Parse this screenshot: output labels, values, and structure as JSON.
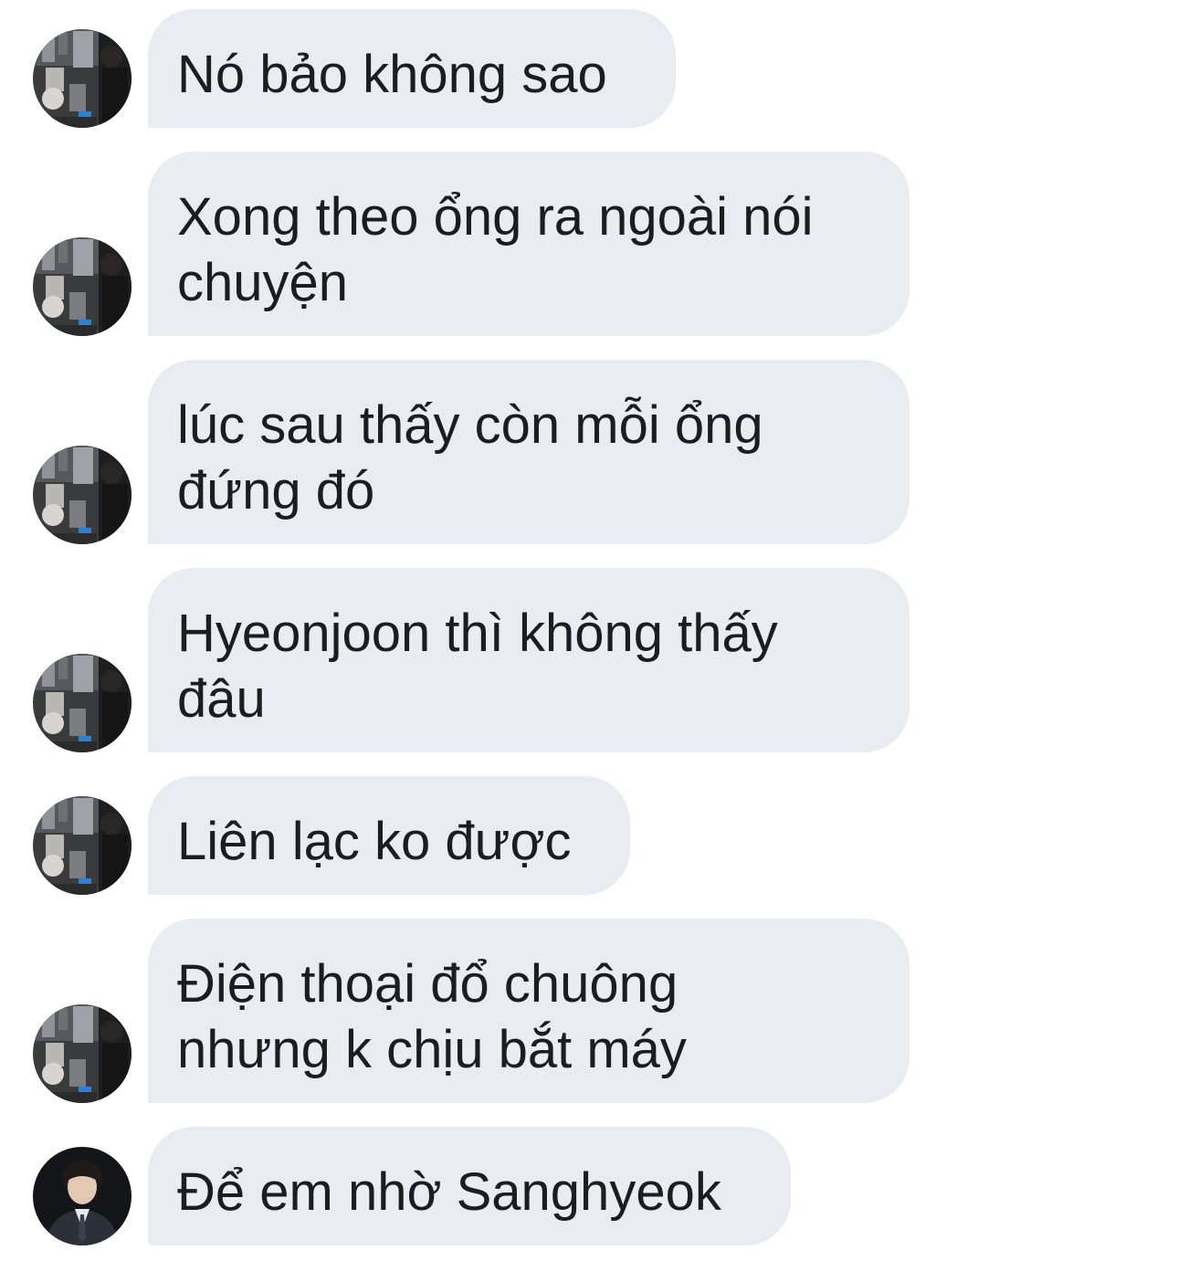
{
  "conversation": {
    "messages": [
      {
        "text": "Nó bảo không sao",
        "avatar": "dark-room-photo"
      },
      {
        "text": "Xong theo ổng ra ngoài nói\nchuyện",
        "avatar": "dark-room-photo"
      },
      {
        "text": "lúc sau thấy còn mỗi ổng\nđứng đó",
        "avatar": "dark-room-photo"
      },
      {
        "text": "Hyeonjoon thì không thấy\nđâu",
        "avatar": "dark-room-photo"
      },
      {
        "text": "Liên lạc ko được",
        "avatar": "dark-room-photo"
      },
      {
        "text": "Điện thoại đổ chuông\nnhưng k chịu bắt máy",
        "avatar": "dark-room-photo"
      },
      {
        "text": "Để em nhờ Sanghyeok",
        "avatar": "person-in-suit-photo"
      }
    ]
  },
  "colors": {
    "bubble_background": "#e9ecf0",
    "text": "#1b1d21",
    "page_background": "#ffffff"
  }
}
